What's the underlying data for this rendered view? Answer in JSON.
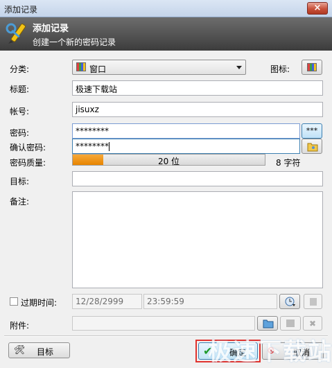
{
  "window": {
    "title": "添加记录",
    "close_glyph": "×"
  },
  "banner": {
    "title": "添加记录",
    "subtitle": "创建一个新的密码记录",
    "icon": "keys-pencil-icon"
  },
  "form": {
    "group_label": "分类:",
    "group_value": "窗口",
    "icon_label": "图标:",
    "title_label": "标题:",
    "title_value": "极速下载站",
    "user_label": "帐号:",
    "user_value": "jisuxz",
    "password_label": "密码:",
    "password_value": "********",
    "toggle_mask_label": "***",
    "repeat_label": "确认密码:",
    "repeat_value": "********",
    "quality_label": "密码质量:",
    "quality_bits_text": "20 位",
    "quality_fraction": 0.16,
    "char_count_text": "8 字符",
    "url_label": "目标:",
    "url_value": "",
    "notes_label": "备注:",
    "notes_value": "",
    "expires_label": "过期时间:",
    "expires_date": "12/28/2999",
    "expires_time": "23:59:59",
    "attachment_label": "附件:",
    "attachment_value": ""
  },
  "footer": {
    "tools_label": "目标",
    "ok_label": "确定",
    "cancel_label": "取消"
  },
  "watermark": {
    "text": "极速下载站"
  },
  "colors": {
    "accent": "#e78400",
    "banner": "#4a4a4a",
    "ok_highlight": "#e0322d"
  }
}
